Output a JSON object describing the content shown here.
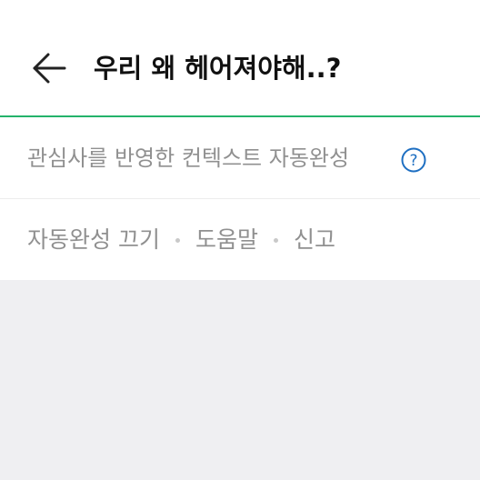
{
  "header": {
    "title": "우리 왜 헤어져야해..?"
  },
  "autocomplete": {
    "context_label": "관심사를 반영한 컨텍스트 자동완성",
    "turn_off_label": "자동완성 끄기",
    "help_label": "도움말",
    "report_label": "신고"
  },
  "colors": {
    "accent_line": "#24b36b",
    "help_icon": "#1e6fc2",
    "background": "#efeff2"
  }
}
